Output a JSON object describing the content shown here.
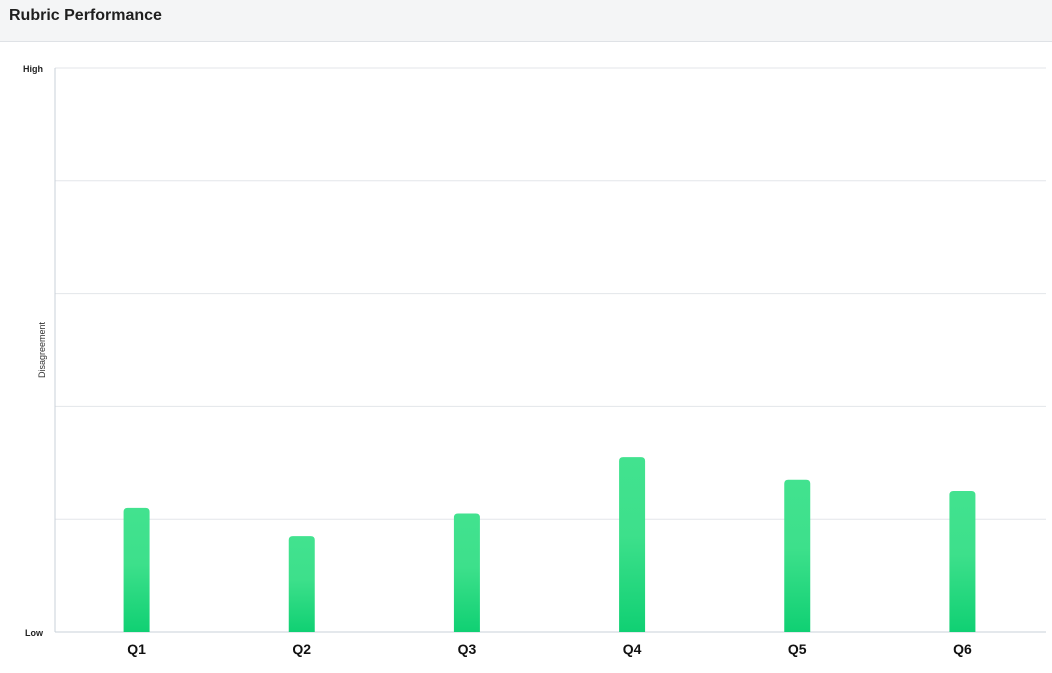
{
  "header": {
    "title": "Rubric Performance"
  },
  "chart_data": {
    "type": "bar",
    "categories": [
      "Q1",
      "Q2",
      "Q3",
      "Q4",
      "Q5",
      "Q6"
    ],
    "values": [
      0.22,
      0.17,
      0.21,
      0.31,
      0.27,
      0.25
    ],
    "ylim": [
      0,
      1
    ],
    "ylabel": "Disagreement",
    "ytick_labels": {
      "low": "Low",
      "high": "High"
    },
    "grid": true,
    "bar_colors": {
      "top": "#42e28f",
      "bottom": "#10d073"
    }
  }
}
